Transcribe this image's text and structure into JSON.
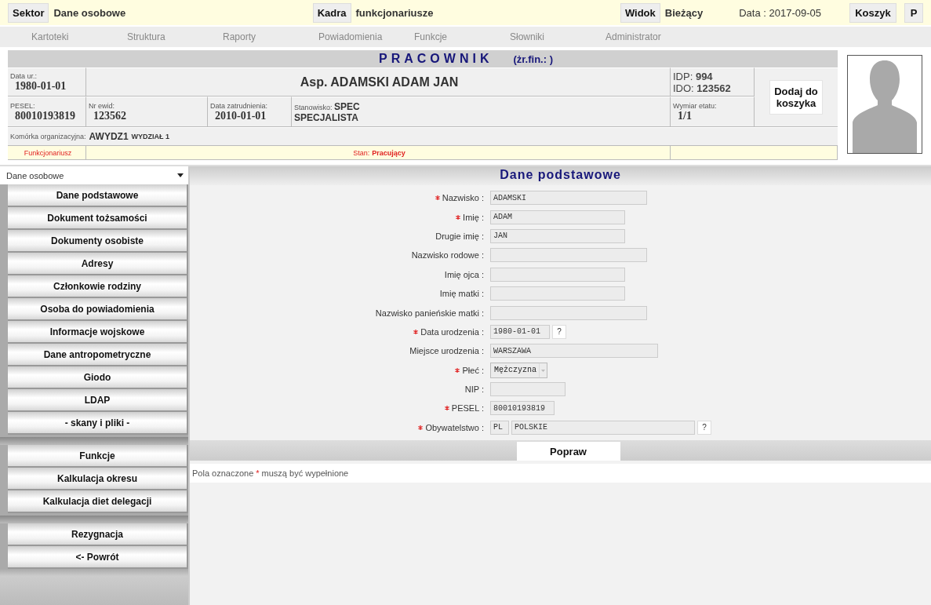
{
  "top_bar": {
    "sector": {
      "label": "Sektor",
      "value": "Dane osobowe"
    },
    "staff": {
      "label": "Kadra",
      "value": "funkcjonariusze"
    },
    "view": {
      "label": "Widok",
      "value": "Bieżący"
    },
    "date": "Data : 2017-09-05",
    "buttons": [
      "Koszyk",
      "P"
    ]
  },
  "nav": [
    "Kartoteki",
    "Struktura",
    "Raporty",
    "Powiadomienia",
    "Funkcje",
    "Słowniki",
    "Administrator"
  ],
  "header": {
    "title": "PRACOWNIK",
    "source": "(żr.fin.: )",
    "birth_date": {
      "label": "Data ur.:",
      "value": "1980-01-01"
    },
    "name": "Asp. ADAMSKI ADAM JAN",
    "idp": {
      "label": "IDP:",
      "value": "994"
    },
    "ido": {
      "label": "IDO:",
      "value": "123562"
    },
    "add_button": "Dodaj do koszyka",
    "pesel": {
      "label": "PESEL:",
      "value": "80010193819"
    },
    "record_no": {
      "label": "Nr ewid:",
      "value": "123562"
    },
    "hire_date": {
      "label": "Data zatrudnienia:",
      "value": "2010-01-01"
    },
    "position": {
      "label": "Stanowisko:",
      "code": "SPEC",
      "value": "SPECJALISTA"
    },
    "fte": {
      "label": "Wymiar etatu:",
      "value": "1/1"
    },
    "unit": {
      "label": "Komórka organizacyjna:",
      "code": "AWYDZ1",
      "value": "WYDZIAŁ 1"
    },
    "type": "Funkcjonariusz",
    "status": {
      "label": "Stan:",
      "value": "Pracujący"
    }
  },
  "sidebar": {
    "select": "Dane osobowe",
    "groups": [
      [
        "Dane podstawowe",
        "Dokument tożsamości",
        "Dokumenty osobiste",
        "Adresy",
        "Członkowie rodziny",
        "Osoba do powiadomienia",
        "Informacje wojskowe",
        "Dane antropometryczne",
        "Giodo",
        "LDAP",
        "- skany i pliki -"
      ],
      [
        "Funkcje",
        "Kalkulacja okresu",
        "Kalkulacja diet delegacji"
      ],
      [
        "Rezygnacja",
        "<- Powrót"
      ]
    ]
  },
  "form": {
    "title": "Dane podstawowe",
    "fields": [
      {
        "kind": "text",
        "label": "Nazwisko :",
        "required": true,
        "value": "ADAMSKI"
      },
      {
        "kind": "text",
        "label": "Imię :",
        "required": true,
        "value": "ADAM"
      },
      {
        "kind": "text",
        "label": "Drugie imię :",
        "required": false,
        "value": "JAN"
      },
      {
        "kind": "text",
        "label": "Nazwisko rodowe :",
        "required": false
      },
      {
        "kind": "text",
        "label": "Imię ojca :",
        "required": false
      },
      {
        "kind": "text",
        "label": "Imię matki :",
        "required": false
      },
      {
        "kind": "text",
        "label": "Nazwisko panieńskie matki :",
        "required": false
      },
      {
        "kind": "date",
        "label": "Data urodzenia :",
        "required": true,
        "value": "1980-01-01",
        "help": "?"
      },
      {
        "kind": "text",
        "label": "Miejsce urodzenia :",
        "required": false,
        "value": "WARSZAWA"
      },
      {
        "kind": "select",
        "label": "Płeć :",
        "required": true,
        "value": "Mężczyzna"
      },
      {
        "kind": "text",
        "label": "NIP :",
        "required": false
      },
      {
        "kind": "text",
        "label": "PESEL :",
        "required": true,
        "value": "80010193819"
      },
      {
        "kind": "code",
        "label": "Obywatelstwo :",
        "required": true,
        "code": "PL",
        "value": "POLSKIE",
        "help": "?"
      }
    ],
    "submit": "Popraw",
    "note": {
      "before": "Pola oznaczone",
      "mark": "*",
      "after": "muszą być wypełnione"
    }
  }
}
